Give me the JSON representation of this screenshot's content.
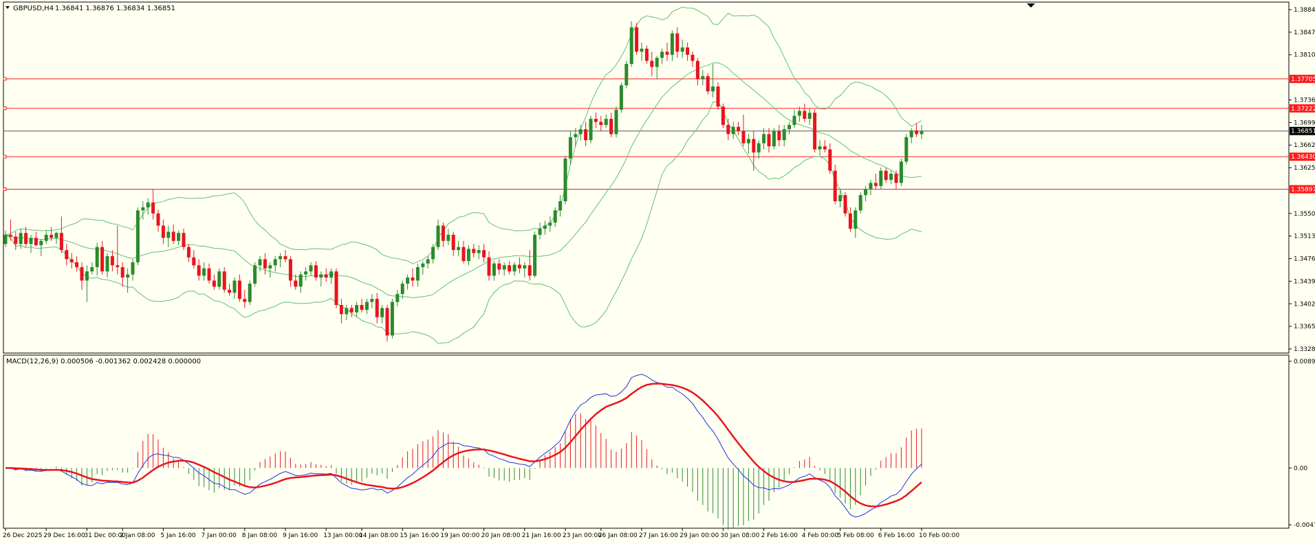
{
  "header": {
    "symbol_label": "GBPUSD,H4",
    "ohlc": "1.36841 1.36876 1.36834 1.36851"
  },
  "macd_header": "MACD(12,26,9) 0.000506 -0.001362 0.002428 0.000000",
  "colors": {
    "background": "#fffff2",
    "bull": "#2a8b2a",
    "bear": "#e8141e",
    "band": "#5fbf75",
    "level": "#ff1a1a",
    "macd": "#1f2fe0",
    "signal": "#e8141e"
  },
  "chart_data": [
    {
      "type": "candlestick",
      "symbol": "GBPUSD",
      "timeframe": "H4",
      "ylim": [
        1.3328,
        1.3884
      ],
      "y_ticks": [
        "1.38840",
        "1.38470",
        "1.38100",
        "1.37360",
        "1.36990",
        "1.36620",
        "1.36250",
        "1.35500",
        "1.35130",
        "1.34760",
        "1.34390",
        "1.34020",
        "1.33650",
        "1.33280"
      ],
      "current_price": "1.36851",
      "levels": [
        "1.37705",
        "1.37222",
        "1.36430",
        "1.35897"
      ],
      "bollinger_bands": true,
      "candles": [
        [
          1.35,
          1.3522,
          1.3495,
          1.3515
        ],
        [
          1.3515,
          1.354,
          1.3505,
          1.3512
        ],
        [
          1.3512,
          1.352,
          1.349,
          1.35
        ],
        [
          1.35,
          1.3525,
          1.3492,
          1.3518
        ],
        [
          1.3518,
          1.3528,
          1.3495,
          1.35
        ],
        [
          1.35,
          1.3515,
          1.3485,
          1.351
        ],
        [
          1.351,
          1.352,
          1.3496,
          1.3498
        ],
        [
          1.3498,
          1.3508,
          1.348,
          1.3505
        ],
        [
          1.3505,
          1.3522,
          1.35,
          1.3515
        ],
        [
          1.3515,
          1.3528,
          1.3505,
          1.351
        ],
        [
          1.351,
          1.352,
          1.35,
          1.3518
        ],
        [
          1.3518,
          1.3545,
          1.3485,
          1.349
        ],
        [
          1.349,
          1.35,
          1.3465,
          1.3475
        ],
        [
          1.3475,
          1.3485,
          1.346,
          1.347
        ],
        [
          1.347,
          1.348,
          1.3455,
          1.3462
        ],
        [
          1.3462,
          1.347,
          1.3425,
          1.344
        ],
        [
          1.344,
          1.3465,
          1.3405,
          1.3455
        ],
        [
          1.3455,
          1.347,
          1.345,
          1.3462
        ],
        [
          1.3462,
          1.3502,
          1.3448,
          1.3495
        ],
        [
          1.3495,
          1.3505,
          1.345,
          1.3455
        ],
        [
          1.3455,
          1.3485,
          1.3445,
          1.348
        ],
        [
          1.348,
          1.349,
          1.3455,
          1.3465
        ],
        [
          1.3465,
          1.353,
          1.345,
          1.3462
        ],
        [
          1.3462,
          1.347,
          1.343,
          1.3445
        ],
        [
          1.3445,
          1.346,
          1.342,
          1.345
        ],
        [
          1.345,
          1.3475,
          1.344,
          1.347
        ],
        [
          1.347,
          1.356,
          1.3465,
          1.3555
        ],
        [
          1.3555,
          1.357,
          1.354,
          1.356
        ],
        [
          1.356,
          1.3575,
          1.3548,
          1.3568
        ],
        [
          1.3568,
          1.359,
          1.354,
          1.355
        ],
        [
          1.355,
          1.3556,
          1.352,
          1.353
        ],
        [
          1.353,
          1.354,
          1.35,
          1.351
        ],
        [
          1.351,
          1.353,
          1.3495,
          1.352
        ],
        [
          1.352,
          1.3532,
          1.35,
          1.3505
        ],
        [
          1.3505,
          1.3522,
          1.3498,
          1.3518
        ],
        [
          1.3518,
          1.3525,
          1.349,
          1.3495
        ],
        [
          1.3495,
          1.35,
          1.347,
          1.3478
        ],
        [
          1.3478,
          1.349,
          1.346,
          1.3465
        ],
        [
          1.3465,
          1.3475,
          1.344,
          1.3448
        ],
        [
          1.3448,
          1.347,
          1.344,
          1.346
        ],
        [
          1.346,
          1.3468,
          1.3435,
          1.344
        ],
        [
          1.344,
          1.345,
          1.3425,
          1.343
        ],
        [
          1.343,
          1.346,
          1.3425,
          1.3455
        ],
        [
          1.3455,
          1.3462,
          1.342,
          1.3425
        ],
        [
          1.3425,
          1.3435,
          1.3415,
          1.342
        ],
        [
          1.342,
          1.3445,
          1.341,
          1.344
        ],
        [
          1.344,
          1.345,
          1.3405,
          1.341
        ],
        [
          1.341,
          1.3425,
          1.3395,
          1.3405
        ],
        [
          1.3405,
          1.344,
          1.34,
          1.3435
        ],
        [
          1.3435,
          1.347,
          1.343,
          1.3465
        ],
        [
          1.3465,
          1.348,
          1.3455,
          1.3475
        ],
        [
          1.3475,
          1.3485,
          1.345,
          1.346
        ],
        [
          1.346,
          1.347,
          1.3445,
          1.3465
        ],
        [
          1.3465,
          1.348,
          1.3455,
          1.3475
        ],
        [
          1.3475,
          1.3485,
          1.3462,
          1.348
        ],
        [
          1.348,
          1.349,
          1.347,
          1.3475
        ],
        [
          1.3475,
          1.348,
          1.343,
          1.344
        ],
        [
          1.344,
          1.345,
          1.3425,
          1.343
        ],
        [
          1.343,
          1.3455,
          1.342,
          1.345
        ],
        [
          1.345,
          1.3462,
          1.344,
          1.3455
        ],
        [
          1.3455,
          1.347,
          1.3448,
          1.3465
        ],
        [
          1.3465,
          1.3472,
          1.344,
          1.3445
        ],
        [
          1.3445,
          1.3455,
          1.343,
          1.345
        ],
        [
          1.345,
          1.346,
          1.3438,
          1.3445
        ],
        [
          1.3445,
          1.346,
          1.3435,
          1.3455
        ],
        [
          1.3455,
          1.346,
          1.3395,
          1.34
        ],
        [
          1.34,
          1.341,
          1.337,
          1.3385
        ],
        [
          1.3385,
          1.34,
          1.3375,
          1.3395
        ],
        [
          1.3395,
          1.34,
          1.338,
          1.3388
        ],
        [
          1.3388,
          1.3405,
          1.338,
          1.34
        ],
        [
          1.34,
          1.341,
          1.3388,
          1.3392
        ],
        [
          1.3392,
          1.341,
          1.3385,
          1.3405
        ],
        [
          1.3405,
          1.3418,
          1.3395,
          1.341
        ],
        [
          1.341,
          1.342,
          1.337,
          1.338
        ],
        [
          1.338,
          1.34,
          1.337,
          1.3395
        ],
        [
          1.3395,
          1.34,
          1.334,
          1.335
        ],
        [
          1.335,
          1.341,
          1.3345,
          1.3405
        ],
        [
          1.3405,
          1.3425,
          1.3398,
          1.3418
        ],
        [
          1.3418,
          1.344,
          1.341,
          1.3435
        ],
        [
          1.3435,
          1.345,
          1.3425,
          1.3445
        ],
        [
          1.3445,
          1.346,
          1.343,
          1.344
        ],
        [
          1.344,
          1.3468,
          1.343,
          1.3462
        ],
        [
          1.3462,
          1.3472,
          1.345,
          1.3468
        ],
        [
          1.3468,
          1.348,
          1.346,
          1.3475
        ],
        [
          1.3475,
          1.35,
          1.3468,
          1.3495
        ],
        [
          1.3495,
          1.354,
          1.349,
          1.353
        ],
        [
          1.353,
          1.3535,
          1.3495,
          1.3505
        ],
        [
          1.3505,
          1.3525,
          1.3498,
          1.3515
        ],
        [
          1.3515,
          1.352,
          1.348,
          1.349
        ],
        [
          1.349,
          1.3505,
          1.348,
          1.3495
        ],
        [
          1.3495,
          1.3505,
          1.3468,
          1.3472
        ],
        [
          1.3472,
          1.3498,
          1.3465,
          1.3492
        ],
        [
          1.3492,
          1.35,
          1.3478,
          1.3485
        ],
        [
          1.3485,
          1.3498,
          1.3475,
          1.349
        ],
        [
          1.349,
          1.35,
          1.347,
          1.3478
        ],
        [
          1.3478,
          1.3488,
          1.344,
          1.3448
        ],
        [
          1.3448,
          1.3472,
          1.344,
          1.3468
        ],
        [
          1.3468,
          1.3475,
          1.345,
          1.3458
        ],
        [
          1.3458,
          1.347,
          1.3448,
          1.3465
        ],
        [
          1.3465,
          1.3472,
          1.345,
          1.3455
        ],
        [
          1.3455,
          1.347,
          1.3448,
          1.3466
        ],
        [
          1.3466,
          1.3478,
          1.3452,
          1.346
        ],
        [
          1.346,
          1.347,
          1.3445,
          1.3465
        ],
        [
          1.3465,
          1.349,
          1.344,
          1.3448
        ],
        [
          1.3448,
          1.352,
          1.3445,
          1.3515
        ],
        [
          1.3515,
          1.3535,
          1.3508,
          1.3525
        ],
        [
          1.3525,
          1.3538,
          1.3515,
          1.353
        ],
        [
          1.353,
          1.3545,
          1.352,
          1.3535
        ],
        [
          1.3535,
          1.356,
          1.3528,
          1.3555
        ],
        [
          1.3555,
          1.358,
          1.3545,
          1.357
        ],
        [
          1.357,
          1.3645,
          1.3565,
          1.364
        ],
        [
          1.364,
          1.3685,
          1.363,
          1.3675
        ],
        [
          1.3675,
          1.369,
          1.366,
          1.368
        ],
        [
          1.368,
          1.3695,
          1.367,
          1.3688
        ],
        [
          1.3688,
          1.37,
          1.366,
          1.367
        ],
        [
          1.367,
          1.371,
          1.3665,
          1.3705
        ],
        [
          1.3705,
          1.3715,
          1.369,
          1.37
        ],
        [
          1.37,
          1.371,
          1.3685,
          1.3695
        ],
        [
          1.3695,
          1.3712,
          1.369,
          1.3705
        ],
        [
          1.3705,
          1.3715,
          1.3675,
          1.368
        ],
        [
          1.368,
          1.3725,
          1.3675,
          1.372
        ],
        [
          1.372,
          1.3765,
          1.3715,
          1.376
        ],
        [
          1.376,
          1.38,
          1.3755,
          1.3795
        ],
        [
          1.3795,
          1.3865,
          1.379,
          1.3855
        ],
        [
          1.3855,
          1.3862,
          1.381,
          1.3815
        ],
        [
          1.3815,
          1.383,
          1.38,
          1.382
        ],
        [
          1.382,
          1.3825,
          1.3795,
          1.38
        ],
        [
          1.38,
          1.3815,
          1.3775,
          1.379
        ],
        [
          1.379,
          1.3808,
          1.377,
          1.3805
        ],
        [
          1.3805,
          1.382,
          1.3795,
          1.3815
        ],
        [
          1.3815,
          1.383,
          1.38,
          1.381
        ],
        [
          1.381,
          1.385,
          1.38,
          1.3845
        ],
        [
          1.3845,
          1.3855,
          1.3805,
          1.3815
        ],
        [
          1.3815,
          1.3835,
          1.3805,
          1.3822
        ],
        [
          1.3822,
          1.383,
          1.38,
          1.381
        ],
        [
          1.381,
          1.3815,
          1.379,
          1.38
        ],
        [
          1.38,
          1.3805,
          1.376,
          1.377
        ],
        [
          1.377,
          1.3785,
          1.376,
          1.3775
        ],
        [
          1.3775,
          1.378,
          1.3745,
          1.375
        ],
        [
          1.375,
          1.3795,
          1.374,
          1.3758
        ],
        [
          1.3758,
          1.3765,
          1.372,
          1.3725
        ],
        [
          1.3725,
          1.373,
          1.369,
          1.3695
        ],
        [
          1.3695,
          1.3705,
          1.367,
          1.368
        ],
        [
          1.368,
          1.37,
          1.3672,
          1.3692
        ],
        [
          1.3692,
          1.37,
          1.3678,
          1.3685
        ],
        [
          1.3685,
          1.3712,
          1.366,
          1.3665
        ],
        [
          1.3665,
          1.368,
          1.3648,
          1.3672
        ],
        [
          1.3672,
          1.3685,
          1.362,
          1.365
        ],
        [
          1.365,
          1.367,
          1.364,
          1.3665
        ],
        [
          1.3665,
          1.369,
          1.3655,
          1.368
        ],
        [
          1.368,
          1.369,
          1.365,
          1.366
        ],
        [
          1.366,
          1.369,
          1.3655,
          1.3685
        ],
        [
          1.3685,
          1.3695,
          1.366,
          1.367
        ],
        [
          1.367,
          1.3695,
          1.366,
          1.3688
        ],
        [
          1.3688,
          1.37,
          1.368,
          1.3695
        ],
        [
          1.3695,
          1.372,
          1.369,
          1.371
        ],
        [
          1.371,
          1.3725,
          1.37,
          1.3718
        ],
        [
          1.3718,
          1.373,
          1.37,
          1.3705
        ],
        [
          1.3705,
          1.3722,
          1.3695,
          1.3715
        ],
        [
          1.3715,
          1.372,
          1.365,
          1.3655
        ],
        [
          1.3655,
          1.367,
          1.3645,
          1.366
        ],
        [
          1.366,
          1.367,
          1.365,
          1.3655
        ],
        [
          1.3655,
          1.3665,
          1.3615,
          1.362
        ],
        [
          1.362,
          1.363,
          1.3565,
          1.357
        ],
        [
          1.357,
          1.359,
          1.356,
          1.358
        ],
        [
          1.358,
          1.3585,
          1.3545,
          1.355
        ],
        [
          1.355,
          1.356,
          1.352,
          1.3525
        ],
        [
          1.3525,
          1.356,
          1.351,
          1.3555
        ],
        [
          1.3555,
          1.3585,
          1.355,
          1.358
        ],
        [
          1.358,
          1.3595,
          1.357,
          1.359
        ],
        [
          1.359,
          1.3605,
          1.358,
          1.36
        ],
        [
          1.36,
          1.3615,
          1.359,
          1.3595
        ],
        [
          1.3595,
          1.3625,
          1.359,
          1.362
        ],
        [
          1.362,
          1.3625,
          1.36,
          1.3605
        ],
        [
          1.3605,
          1.362,
          1.3598,
          1.3615
        ],
        [
          1.3615,
          1.362,
          1.359,
          1.36
        ],
        [
          1.36,
          1.364,
          1.3595,
          1.3635
        ],
        [
          1.3635,
          1.368,
          1.363,
          1.3675
        ],
        [
          1.3675,
          1.369,
          1.3665,
          1.3686
        ],
        [
          1.3686,
          1.3698,
          1.3675,
          1.368
        ],
        [
          1.368,
          1.3695,
          1.3672,
          1.3685
        ]
      ]
    },
    {
      "type": "line",
      "name": "MACD(12,26,9)",
      "ylim": [
        -0.00474,
        0.0089
      ],
      "y_ticks": [
        "0.00890",
        "0.00",
        "-0.00474"
      ],
      "series_points": 12
    }
  ],
  "x_ticks": [
    "26 Dec 2025",
    "29 Dec 16:00",
    "31 Dec 00:00",
    "2 Jan 08:00",
    "5 Jan 16:00",
    "7 Jan 00:00",
    "8 Jan 08:00",
    "9 Jan 16:00",
    "13 Jan 00:00",
    "14 Jan 08:00",
    "15 Jan 16:00",
    "19 Jan 00:00",
    "20 Jan 08:00",
    "21 Jan 16:00",
    "23 Jan 00:00",
    "26 Jan 08:00",
    "27 Jan 16:00",
    "29 Jan 00:00",
    "30 Jan 08:00",
    "2 Feb 16:00",
    "4 Feb 00:00",
    "5 Feb 08:00",
    "6 Feb 16:00",
    "10 Feb 00:00"
  ]
}
